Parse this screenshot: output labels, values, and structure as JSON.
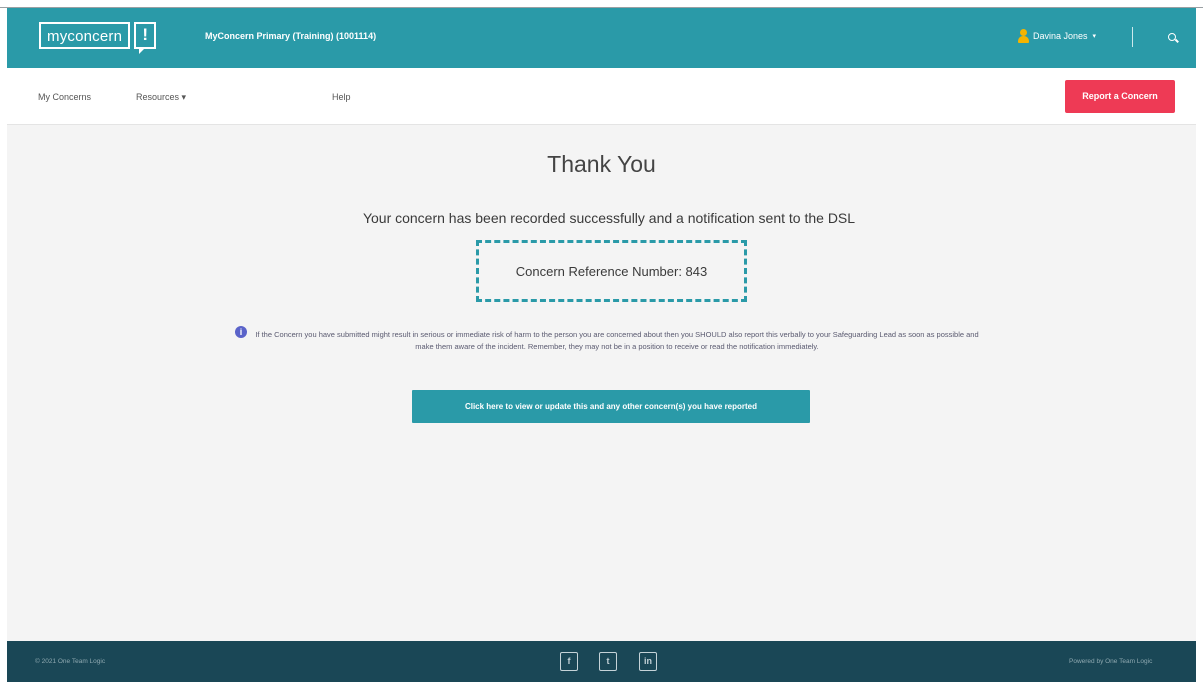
{
  "header": {
    "logo_text": "myconcern",
    "logo_mark": "!",
    "org_name": "MyConcern Primary (Training) (1001114)",
    "user_name": "Davina Jones",
    "user_caret": "▾",
    "user_icon": "user-icon",
    "search_icon": "search-icon"
  },
  "nav": {
    "my_concerns": "My Concerns",
    "resources": "Resources ▾",
    "help": "Help",
    "report_button": "Report a Concern"
  },
  "main": {
    "title": "Thank You",
    "subtitle": "Your concern has been recorded successfully and a notification sent to the DSL",
    "reference": "Concern Reference Number: 843",
    "info_icon": "i",
    "info_text": "If the Concern you have submitted might result in serious or immediate risk of harm to the person you are concerned about then you SHOULD also report this verbally to your Safeguarding Lead as soon as possible and make them aware of the incident. Remember, they may not be in a position to receive or read the notification immediately.",
    "view_button": "Click here to view or update this and any other concern(s) you have reported"
  },
  "footer": {
    "copyright": "© 2021 One Team Logic",
    "powered_by": "Powered by One Team Logic",
    "facebook": "f",
    "twitter": "t",
    "linkedin": "in"
  },
  "colors": {
    "brand_teal": "#2a9aa8",
    "report_red": "#ee3a55",
    "footer_navy": "#1a4756",
    "info_blue": "#5a63c9"
  }
}
